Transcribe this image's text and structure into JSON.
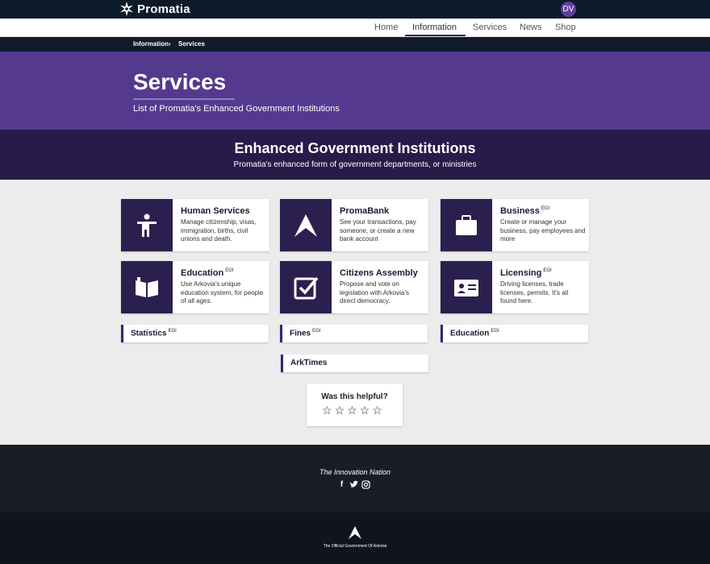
{
  "header": {
    "brand": "Promatia",
    "avatar_initials": "DV"
  },
  "nav": {
    "items": [
      "Home",
      "Information",
      "Services",
      "News",
      "Shop"
    ],
    "active": "Information"
  },
  "breadcrumb": [
    "Information",
    "Services"
  ],
  "hero": {
    "title": "Services",
    "subtitle": "List of Promatia's Enhanced Government Institutions"
  },
  "band": {
    "title": "Enhanced Government Institutions",
    "subtitle": "Promatia's enhanced form of government departments, or ministries"
  },
  "cards": [
    {
      "title": "Human Services",
      "badge": "",
      "desc": "Manage citizenship, visas, immigration, births, civil unions and death.",
      "icon": "person-icon"
    },
    {
      "title": "PromaBank",
      "badge": "",
      "desc": "See your transactions, pay someone, or create a new bank account",
      "icon": "arrow-logo-icon"
    },
    {
      "title": "Business",
      "badge": "EGI",
      "desc": "Create or manage your business, pay employees and more",
      "icon": "briefcase-icon"
    },
    {
      "title": "Education",
      "badge": "EGI",
      "desc": "Use Arkovia's unique education system, for people of all ages.",
      "icon": "book-icon"
    },
    {
      "title": "Citizens Assembly",
      "badge": "",
      "desc": "Propose and vote on legislation with Arkovia's direct democracy.",
      "icon": "checkbox-icon"
    },
    {
      "title": "Licensing",
      "badge": "EGI",
      "desc": "Driving licenses, trade licenses, permits. It's all found here.",
      "icon": "id-card-icon"
    }
  ],
  "chips": [
    {
      "label": "Statistics",
      "badge": "EGI"
    },
    {
      "label": "Fines",
      "badge": "EGI"
    },
    {
      "label": "Education",
      "badge": "EGI"
    },
    {
      "label": "ArkTimes",
      "badge": ""
    }
  ],
  "feedback": {
    "question": "Was this helpful?",
    "rating": 0,
    "max": 5
  },
  "footer": {
    "tagline": "The Innovation Nation",
    "socials": [
      "facebook-icon",
      "twitter-icon",
      "instagram-icon"
    ],
    "caption": "The Official Government Of Arkovia"
  },
  "colors": {
    "primary": "#55398f",
    "dark": "#271b49",
    "icon_bg": "#2b1f4f",
    "topbar": "#0d1a2a"
  }
}
